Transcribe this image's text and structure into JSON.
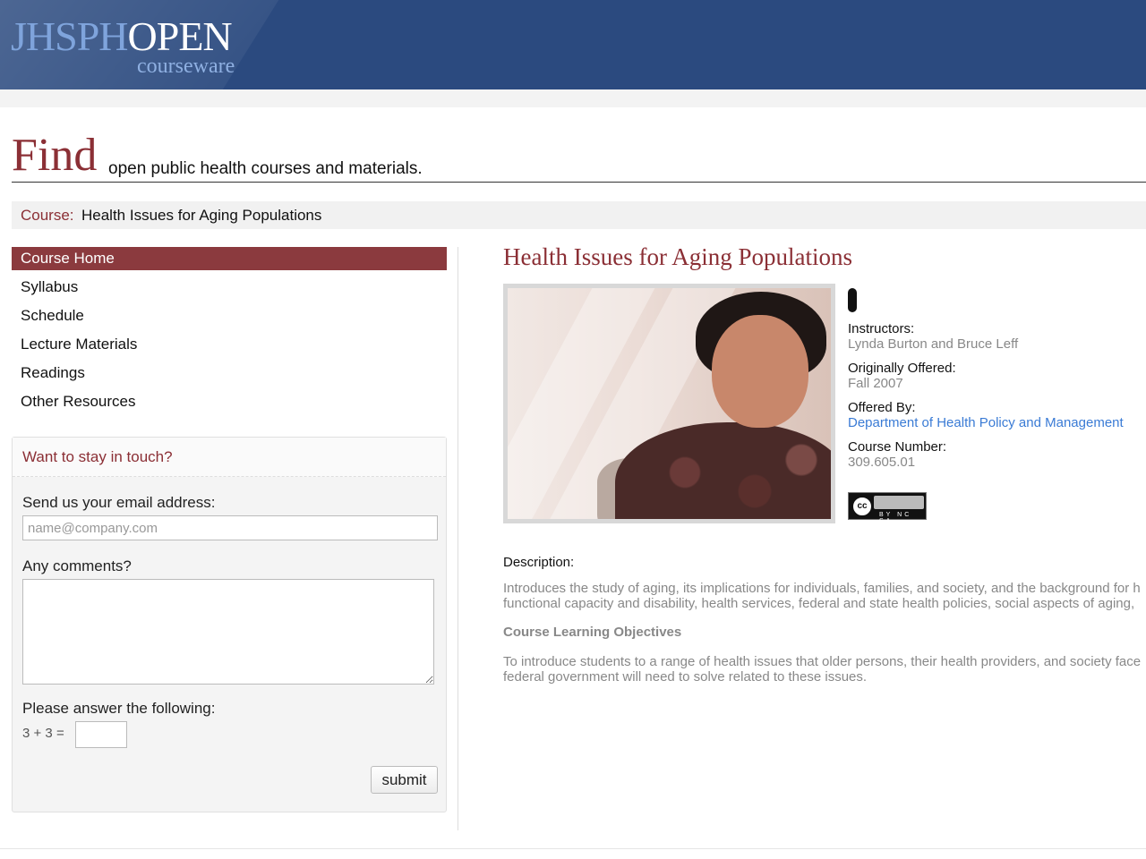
{
  "header": {
    "logo_part1": "JHSPH",
    "logo_part2": "OPEN",
    "logo_sub": "courseware"
  },
  "find": {
    "big_word": "Find",
    "rest": "open public health courses and materials."
  },
  "breadcrumb": {
    "label": "Course:",
    "value": "Health Issues for Aging Populations"
  },
  "nav": {
    "items": [
      {
        "label": "Course Home"
      },
      {
        "label": "Syllabus"
      },
      {
        "label": "Schedule"
      },
      {
        "label": "Lecture Materials"
      },
      {
        "label": "Readings"
      },
      {
        "label": "Other Resources"
      }
    ]
  },
  "contact": {
    "heading": "Want to stay in touch?",
    "email_label": "Send us your email address:",
    "email_placeholder": "name@company.com",
    "comments_label": "Any comments?",
    "captcha_label": "Please answer the following:",
    "captcha_question": "3 + 3 =",
    "submit_label": "submit"
  },
  "course": {
    "title": "Health Issues for Aging Populations",
    "instructors_label": "Instructors:",
    "instructors": "Lynda Burton and Bruce Leff",
    "offered_label": "Originally Offered:",
    "offered": "Fall 2007",
    "offered_by_label": "Offered By:",
    "offered_by": "Department of Health Policy and Management",
    "number_label": "Course Number:",
    "number": "309.605.01",
    "license": {
      "cc": "cc",
      "terms": "BY NC SA"
    },
    "description_label": "Description:",
    "description_line1": "Introduces the study of aging, its implications for individuals, families, and society, and the background for h",
    "description_line2": "functional capacity and disability, health services, federal and state health policies, social aspects of aging,",
    "objectives_heading": "Course Learning Objectives",
    "objectives_line1": "To introduce students to a range of health issues that older persons, their health providers, and society face",
    "objectives_line2": "federal government will need to solve related to these issues."
  },
  "colors": {
    "brand_blue": "#2b4a7f",
    "accent_maroon": "#8b2f35",
    "link_blue": "#3a7bd5"
  }
}
